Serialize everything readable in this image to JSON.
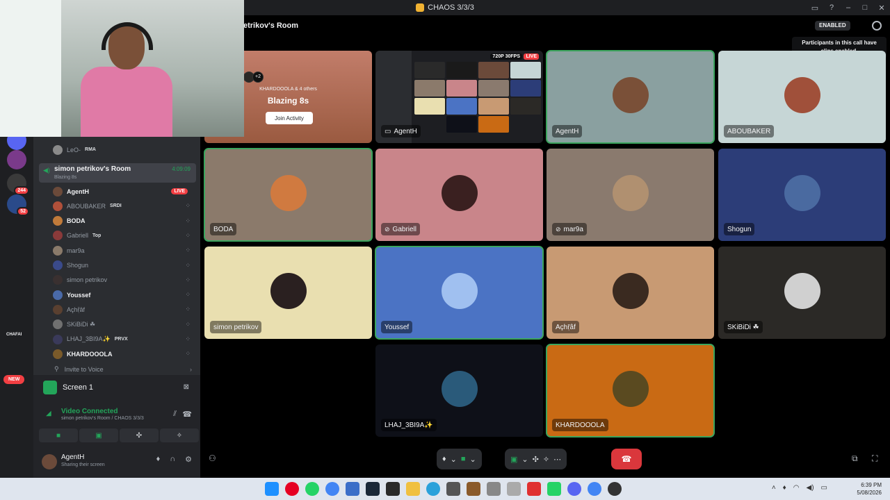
{
  "window": {
    "title": "CHAOS 3/3/3"
  },
  "servers": [
    {
      "badge": "",
      "color": "#3a7a3a"
    },
    {
      "badge": "1",
      "color": "#6a4a3a"
    },
    {
      "badge": "305",
      "color": "#c8d400"
    },
    {
      "badge": "4",
      "color": "#8a6a20"
    },
    {
      "badge": "50",
      "color": "#2a3a5a"
    },
    {
      "badge": "20",
      "color": "#a04020"
    },
    {
      "badge": "",
      "color": "#5865f2"
    },
    {
      "badge": "",
      "color": "#7a3a8a"
    },
    {
      "badge": "244",
      "color": "#3a3a3a"
    },
    {
      "badge": "52",
      "color": "#2a4a8a"
    }
  ],
  "rail": {
    "category_label": "CHAFAI",
    "new_label": "NEW"
  },
  "sidebar": {
    "top_user": {
      "name": "LeO-",
      "tag": "RMA"
    },
    "room": {
      "name": "simon petrikov's Room",
      "subtitle": "Blazing 8s",
      "timer": "4:09:09"
    },
    "members": [
      {
        "name": "AgentH",
        "tag": "",
        "live": "LIVE",
        "bright": true,
        "color": "#6b4a3a"
      },
      {
        "name": "ABOUBAKER",
        "tag": "SRDI",
        "live": "",
        "bright": false,
        "color": "#b0503a"
      },
      {
        "name": "BODA",
        "tag": "",
        "live": "",
        "bright": true,
        "color": "#c07a3a"
      },
      {
        "name": "Gabriell",
        "tag": "Top",
        "live": "",
        "bright": false,
        "color": "#8a3a3a"
      },
      {
        "name": "mar9a",
        "tag": "",
        "live": "",
        "bright": false,
        "color": "#8a7a6a"
      },
      {
        "name": "Shogun",
        "tag": "",
        "live": "",
        "bright": false,
        "color": "#3a4a8a"
      },
      {
        "name": "simon petrikov",
        "tag": "",
        "live": "",
        "bright": false,
        "color": "#3a3030"
      },
      {
        "name": "Youssef",
        "tag": "",
        "live": "",
        "bright": true,
        "color": "#4a6aa8"
      },
      {
        "name": "Açhṝâf",
        "tag": "",
        "live": "",
        "bright": false,
        "color": "#5a4030"
      },
      {
        "name": "SKiBiDi ☘",
        "tag": "",
        "live": "",
        "bright": false,
        "color": "#707070"
      },
      {
        "name": "LHAJ_3BI9A✨",
        "tag": "PRVX",
        "live": "",
        "bright": false,
        "color": "#3a3a5a"
      },
      {
        "name": "KHARDOOOLA",
        "tag": "",
        "live": "",
        "bright": true,
        "color": "#7a5a2a"
      }
    ],
    "invite": "Invite to Voice"
  },
  "screen_panel": {
    "title": "Screen 1",
    "status": "Video Connected",
    "location": "simon petrikov's Room / CHAOS 3/3/3"
  },
  "user_panel": {
    "name": "AgentH",
    "status": "Sharing their screen"
  },
  "stage": {
    "room_title": "etrikov's Room",
    "clips_label": "ENABLED",
    "tooltip": "Participants in this call have clips enabled.",
    "activity": {
      "extra": "+2",
      "hosts": "KHARDOOOLA & 4 others",
      "title": "Blazing 8s",
      "button": "Join Activity"
    },
    "stream": {
      "name": "AgentH",
      "quality": "720P 30FPS",
      "live": "LIVE"
    },
    "tiles": [
      {
        "name": "AgentH",
        "muted": false,
        "bg": "#8aa0a0",
        "av": "#7a5038",
        "speaking": true
      },
      {
        "name": "ABOUBAKER",
        "muted": false,
        "bg": "#c6d6d6",
        "av": "#a0503a",
        "speaking": false
      },
      {
        "name": "BODA",
        "muted": false,
        "bg": "#8b7a6b",
        "av": "#d07a40",
        "speaking": true
      },
      {
        "name": "Gabriell",
        "muted": true,
        "bg": "#c9858a",
        "av": "#3a2020",
        "speaking": false
      },
      {
        "name": "mar9a",
        "muted": true,
        "bg": "#8a7a6e",
        "av": "#b09070",
        "speaking": false
      },
      {
        "name": "Shogun",
        "muted": false,
        "bg": "#2c3d78",
        "av": "#4a6aa0",
        "speaking": false
      },
      {
        "name": "simon petrikov",
        "muted": false,
        "bg": "#e9dfb0",
        "av": "#2a2020",
        "speaking": false
      },
      {
        "name": "Youssef",
        "muted": false,
        "bg": "#4b73c4",
        "av": "#a0c0f0",
        "speaking": true
      },
      {
        "name": "Açhṝâf",
        "muted": false,
        "bg": "#c89a73",
        "av": "#3a2a20",
        "speaking": false
      },
      {
        "name": "SKiBiDi ☘",
        "muted": false,
        "bg": "#2b2926",
        "av": "#d0d0d0",
        "speaking": false
      },
      {
        "name": "LHAJ_3BI9A✨",
        "muted": false,
        "bg": "#0e1018",
        "av": "#2a5a7a",
        "speaking": false
      },
      {
        "name": "KHARDOOOLA",
        "muted": false,
        "bg": "#c96a14",
        "av": "#5a4a20",
        "speaking": true
      }
    ]
  },
  "taskbar": {
    "time": "6:39 PM",
    "date": "5/08/2026"
  },
  "colors": {
    "accent": "#23a55a",
    "danger": "#da373c",
    "live": "#f23f43"
  }
}
